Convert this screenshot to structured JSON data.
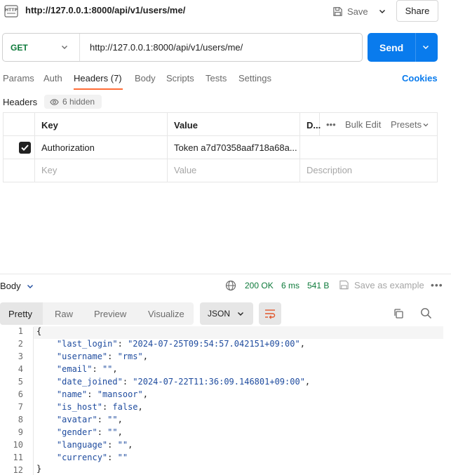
{
  "header": {
    "title": "http://127.0.0.1:8000/api/v1/users/me/",
    "save_label": "Save",
    "share_label": "Share",
    "icon": "http-request-icon"
  },
  "request": {
    "method": "GET",
    "url": "http://127.0.0.1:8000/api/v1/users/me/",
    "send_label": "Send"
  },
  "tabs": {
    "items": [
      "Params",
      "Auth",
      "Headers (7)",
      "Body",
      "Scripts",
      "Tests",
      "Settings"
    ],
    "active": "Headers (7)",
    "cookies_label": "Cookies"
  },
  "headers_section": {
    "label": "Headers",
    "hidden_count": "6 hidden"
  },
  "headers_table": {
    "columns": {
      "key": "Key",
      "value": "Value",
      "description": "D..."
    },
    "actions": {
      "bulk_edit": "Bulk Edit",
      "presets": "Presets"
    },
    "rows": [
      {
        "checked": true,
        "key": "Authorization",
        "value": "Token a7d70358aaf718a68a..."
      }
    ],
    "placeholder": {
      "key": "Key",
      "value": "Value",
      "description": "Description"
    }
  },
  "response": {
    "body_label": "Body",
    "status": "200 OK",
    "time": "6 ms",
    "size": "541 B",
    "save_example_label": "Save as example",
    "view_tabs": [
      "Pretty",
      "Raw",
      "Preview",
      "Visualize"
    ],
    "active_view": "Pretty",
    "format": "JSON",
    "line_numbers": [
      "1",
      "2",
      "3",
      "4",
      "5",
      "6",
      "7",
      "8",
      "9",
      "10",
      "11",
      "12"
    ],
    "fields": [
      {
        "key": "\"last_login\"",
        "value": "\"2024-07-25T09:54:57.042151+09:00\"",
        "comma": true
      },
      {
        "key": "\"username\"",
        "value": "\"rms\"",
        "comma": true
      },
      {
        "key": "\"email\"",
        "value": "\"\"",
        "comma": true
      },
      {
        "key": "\"date_joined\"",
        "value": "\"2024-07-22T11:36:09.146801+09:00\"",
        "comma": true
      },
      {
        "key": "\"name\"",
        "value": "\"mansoor\"",
        "comma": true
      },
      {
        "key": "\"is_host\"",
        "value": "false",
        "comma": true
      },
      {
        "key": "\"avatar\"",
        "value": "\"\"",
        "comma": true
      },
      {
        "key": "\"gender\"",
        "value": "\"\"",
        "comma": true
      },
      {
        "key": "\"language\"",
        "value": "\"\"",
        "comma": true
      },
      {
        "key": "\"currency\"",
        "value": "\"\"",
        "comma": false
      }
    ],
    "open_brace": "{",
    "close_brace": "}"
  },
  "colors": {
    "accent": "#097bed",
    "active_tab_underline": "#ff6c37",
    "status_ok": "#0d7a3a",
    "code_text": "#1e4b9e"
  }
}
